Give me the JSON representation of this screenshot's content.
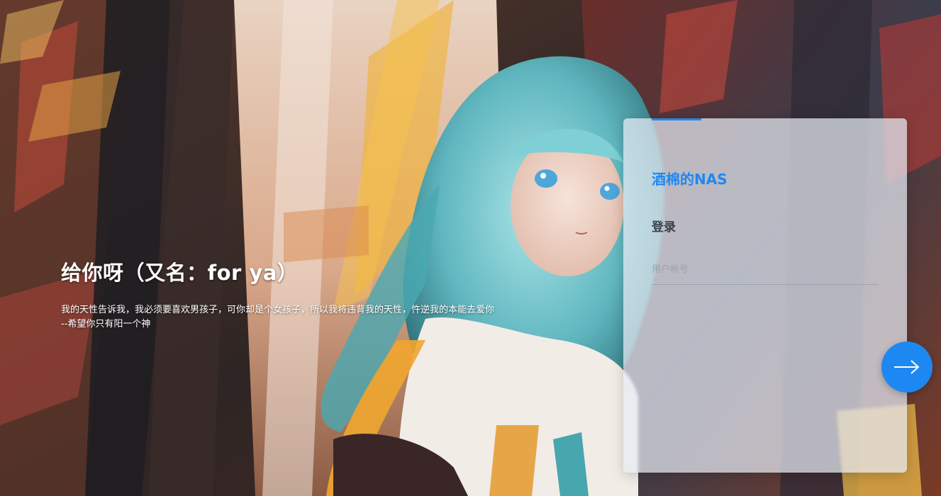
{
  "hero": {
    "title": "给你呀（又名：for ya）",
    "line1": "我的天性告诉我，我必须要喜欢男孩子，可你却是个女孩子，所以我将违背我的天性，忤逆我的本能去爱你",
    "line2": "--希望你只有阳一个神"
  },
  "login": {
    "brand": "酒棉的NAS",
    "title": "登录",
    "username_placeholder": "用户帐号",
    "username_value": ""
  },
  "submit": {
    "icon": "arrow-right-icon"
  },
  "colors": {
    "accent": "#1e88f2",
    "panel_bg": "#e8ecf4",
    "text_dark": "#3a3f4a"
  }
}
